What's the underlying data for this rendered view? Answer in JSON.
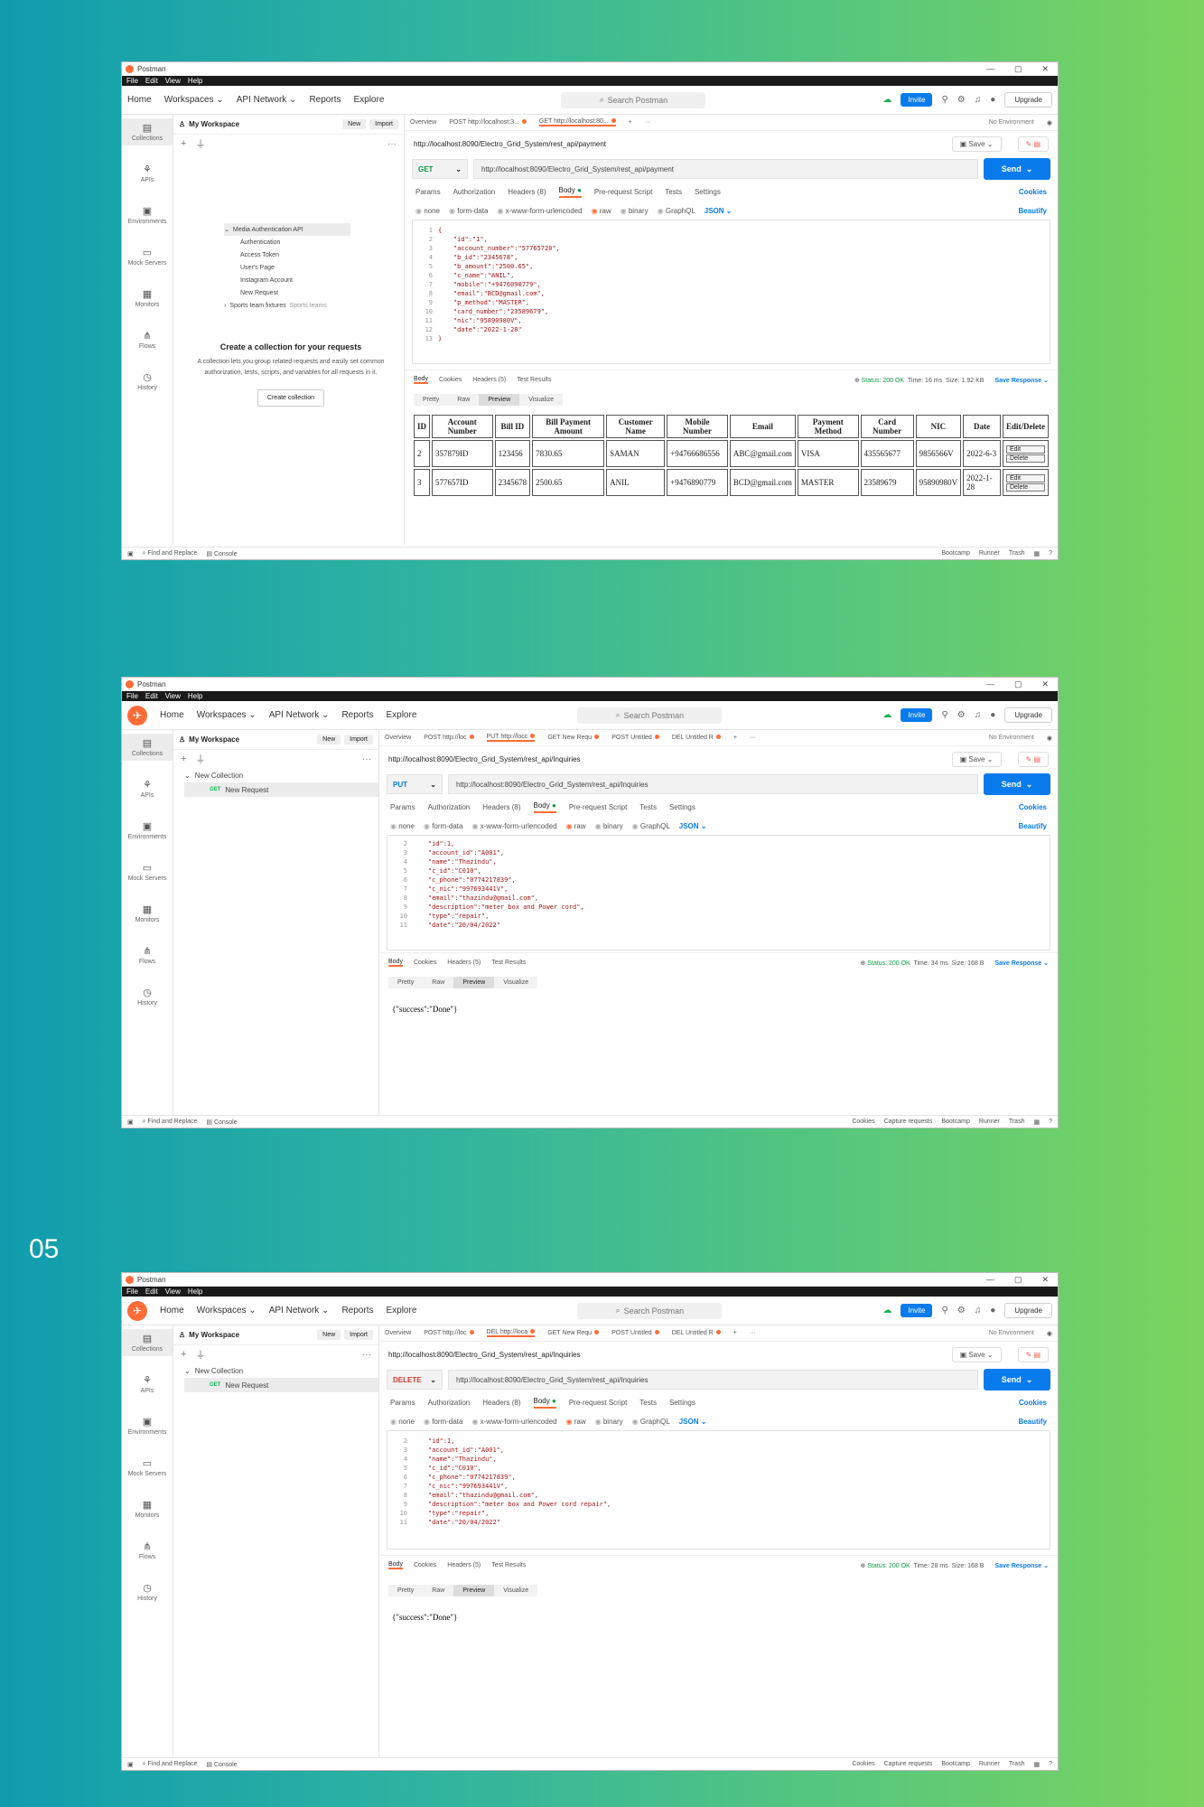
{
  "slide_number": "05",
  "titlebar": {
    "app": "Postman",
    "controls": [
      "—",
      "▢",
      "✕"
    ]
  },
  "menu": [
    "File",
    "Edit",
    "View",
    "Help"
  ],
  "header": {
    "nav": [
      "Home",
      "Workspaces",
      "API Network",
      "Reports",
      "Explore"
    ],
    "search_placeholder": "Search Postman",
    "invite": "Invite",
    "upgrade": "Upgrade"
  },
  "rail": [
    "Collections",
    "APIs",
    "Environments",
    "Mock Servers",
    "Monitors",
    "Flows",
    "History"
  ],
  "workspace": {
    "name": "My Workspace",
    "new": "New",
    "import": "Import"
  },
  "no_environment": "No Environment",
  "subtabs": [
    "Params",
    "Authorization",
    "Headers (8)",
    "Body",
    "Pre-request Script",
    "Tests",
    "Settings"
  ],
  "cookies": "Cookies",
  "radios": [
    "none",
    "form-data",
    "x-www-form-urlencoded",
    "raw",
    "binary",
    "GraphQL"
  ],
  "json_label": "JSON",
  "beautify": "Beautify",
  "resp_tabs": [
    "Body",
    "Cookies",
    "Headers (5)",
    "Test Results"
  ],
  "views": [
    "Pretty",
    "Raw",
    "Preview",
    "Visualize"
  ],
  "save_response": "Save Response",
  "save": "Save",
  "send": "Send",
  "statusbar": {
    "left": [
      "Find and Replace",
      "Console"
    ],
    "right1": [
      "Bootcamp",
      "Runner",
      "Trash"
    ],
    "right2": [
      "Cookies",
      "Capture requests",
      "Bootcamp",
      "Runner",
      "Trash"
    ]
  },
  "win1": {
    "tabs": [
      "Overview",
      "POST http://localhost:3...",
      "GET http://localhost:80..."
    ],
    "title_url": "http://localhost:8090/Electro_Grid_System/rest_api/payment",
    "method": "GET",
    "url": "http://localhost:8090/Electro_Grid_System/rest_api/payment",
    "tree": [
      "Media Authentication API",
      "Authentication",
      "Access Token",
      "User's Page",
      "Instagram Account",
      "New Request",
      "Sports team fixtures"
    ],
    "tree_tag": "Sports teams",
    "cc_title": "Create a collection for your requests",
    "cc_text": "A collection lets you group related requests and easily set common authorization, tests, scripts, and variables for all requests in it.",
    "cc_button": "Create collection",
    "code": [
      {
        "n": "1",
        "t": "{"
      },
      {
        "n": "2",
        "t": "    \"id\":\"1\","
      },
      {
        "n": "3",
        "t": "    \"account_number\":\"57765720\","
      },
      {
        "n": "4",
        "t": "    \"b_id\":\"2345678\","
      },
      {
        "n": "5",
        "t": "    \"b_amount\":\"2500.65\","
      },
      {
        "n": "6",
        "t": "    \"c_name\":\"ANIL\","
      },
      {
        "n": "7",
        "t": "    \"mobile\":\"+9476090779\","
      },
      {
        "n": "8",
        "t": "    \"email\":\"BCD@gmail.com\","
      },
      {
        "n": "9",
        "t": "    \"p_method\":\"MASTER\","
      },
      {
        "n": "10",
        "t": "    \"card_number\":\"23589679\","
      },
      {
        "n": "11",
        "t": "    \"nic\":\"95890980V\","
      },
      {
        "n": "12",
        "t": "    \"date\":\"2022-1-28\""
      },
      {
        "n": "13",
        "t": "}"
      }
    ],
    "status": "Status: 200 OK",
    "time": "Time: 16 ms",
    "size": "Size: 1.92 KB",
    "table": {
      "headers": [
        "ID",
        "Account Number",
        "Bill ID",
        "Bill Payment Amount",
        "Customer Name",
        "Mobile Number",
        "Email",
        "Payment Method",
        "Card Number",
        "NIC",
        "Date",
        "Edit/Delete"
      ],
      "rows": [
        [
          "2",
          "357879ID",
          "123456",
          "7830.65",
          "SAMAN",
          "+94766686556",
          "ABC@gmail.com",
          "VISA",
          "435565677",
          "9856566V",
          "2022-6-3"
        ],
        [
          "3",
          "577657ID",
          "2345678",
          "2500.65",
          "ANIL",
          "+9476890779",
          "BCD@gmail.com",
          "MASTER",
          "23589679",
          "95890980V",
          "2022-1-28"
        ]
      ],
      "edit": "Edit",
      "delete": "Delete"
    }
  },
  "win2": {
    "tabs": [
      "Overview",
      "POST http://loc",
      "PUT http://locc",
      "GET New Requ",
      "POST Untitled",
      "DEL Untitled R"
    ],
    "title_url": "http://localhost:8090/Electro_Grid_System/rest_api/Inquiries",
    "method": "PUT",
    "url": "http://localhost:8090/Electro_Grid_System/rest_api/Inquiries",
    "collection": "New Collection",
    "request": "New Request",
    "code": [
      {
        "n": "2",
        "t": "    \"id\":1,"
      },
      {
        "n": "3",
        "t": "    \"account_id\":\"A001\","
      },
      {
        "n": "4",
        "t": "    \"name\":\"Thazindu\","
      },
      {
        "n": "5",
        "t": "    \"c_id\":\"C010\","
      },
      {
        "n": "6",
        "t": "    \"c_phone\":\"0774217839\","
      },
      {
        "n": "7",
        "t": "    \"c_nic\":\"997693441V\","
      },
      {
        "n": "8",
        "t": "    \"email\":\"thazindu@gmail.com\","
      },
      {
        "n": "9",
        "t": "    \"description\":\"meter box and Power cord\","
      },
      {
        "n": "10",
        "t": "    \"type\":\"repair\","
      },
      {
        "n": "11",
        "t": "    \"date\":\"20/04/2022\""
      }
    ],
    "status": "Status: 200 OK",
    "time": "Time: 34 ms",
    "size": "Size: 168 B",
    "result": "{\"success\":\"Done\"}"
  },
  "win3": {
    "tabs": [
      "Overview",
      "POST http://loc",
      "DEL http://loca",
      "GET New Requ",
      "POST Untitled",
      "DEL Untitled R"
    ],
    "title_url": "http://localhost:8090/Electro_Grid_System/rest_api/Inquiries",
    "method": "DELETE",
    "url": "http://localhost:8090/Electro_Grid_System/rest_api/Inquiries",
    "collection": "New Collection",
    "request": "New Request",
    "code": [
      {
        "n": "2",
        "t": "    \"id\":1,"
      },
      {
        "n": "3",
        "t": "    \"account_id\":\"A001\","
      },
      {
        "n": "4",
        "t": "    \"name\":\"Thazindu\","
      },
      {
        "n": "5",
        "t": "    \"c_id\":\"C010\","
      },
      {
        "n": "6",
        "t": "    \"c_phone\":\"0774217839\","
      },
      {
        "n": "7",
        "t": "    \"c_nic\":\"997693441V\","
      },
      {
        "n": "8",
        "t": "    \"email\":\"thazindu@gmail.com\","
      },
      {
        "n": "9",
        "t": "    \"description\":\"meter box and Power cord repair\","
      },
      {
        "n": "10",
        "t": "    \"type\":\"repair\","
      },
      {
        "n": "11",
        "t": "    \"date\":\"20/04/2022\""
      }
    ],
    "status": "Status: 200 OK",
    "time": "Time: 28 ms",
    "size": "Size: 168 B",
    "result": "{\"success\":\"Done\"}"
  }
}
